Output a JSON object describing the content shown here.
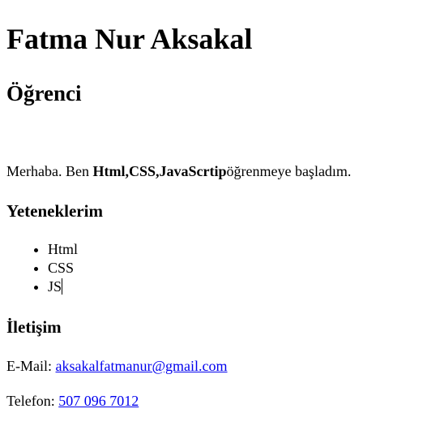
{
  "name": "Fatma Nur Aksakal",
  "role": "Öğrenci",
  "intro": {
    "prefix": "Merhaba. Ben ",
    "bold": "Html,CSS,JavaScrtip",
    "suffix": "öğrenmeye başladım."
  },
  "skills": {
    "heading": "Yeteneklerim",
    "items": [
      "Html",
      "CSS",
      "JS"
    ]
  },
  "contact": {
    "heading": "İletişim",
    "email_label": "E-Mail: ",
    "email": "aksakalfatmanur@gmail.com",
    "phone_label": "Telefon: ",
    "phone": "507 096 7012"
  }
}
